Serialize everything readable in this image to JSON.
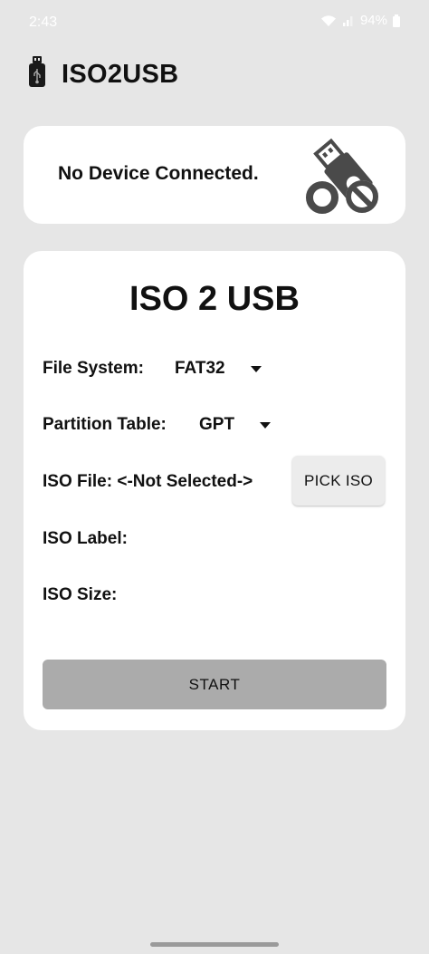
{
  "status_bar": {
    "time": "2:43",
    "battery": "94%"
  },
  "header": {
    "app_title": "ISO2USB",
    "icon": "usb-drive-icon"
  },
  "device_card": {
    "status_text": "No Device Connected.",
    "icon": "usb-disconnected-icon"
  },
  "main": {
    "title": "ISO 2 USB",
    "file_system": {
      "label": "File System:",
      "value": "FAT32"
    },
    "partition_table": {
      "label": "Partition Table:",
      "value": "GPT"
    },
    "iso_file": {
      "label": "ISO File: <-Not Selected->"
    },
    "pick_iso_label": "PICK ISO",
    "iso_label": {
      "label": "ISO Label:"
    },
    "iso_size": {
      "label": "ISO Size:"
    },
    "start_label": "START"
  },
  "colors": {
    "background": "#e6e6e6",
    "card": "#ffffff",
    "start_button": "#ababab",
    "pick_button": "#ececec"
  }
}
